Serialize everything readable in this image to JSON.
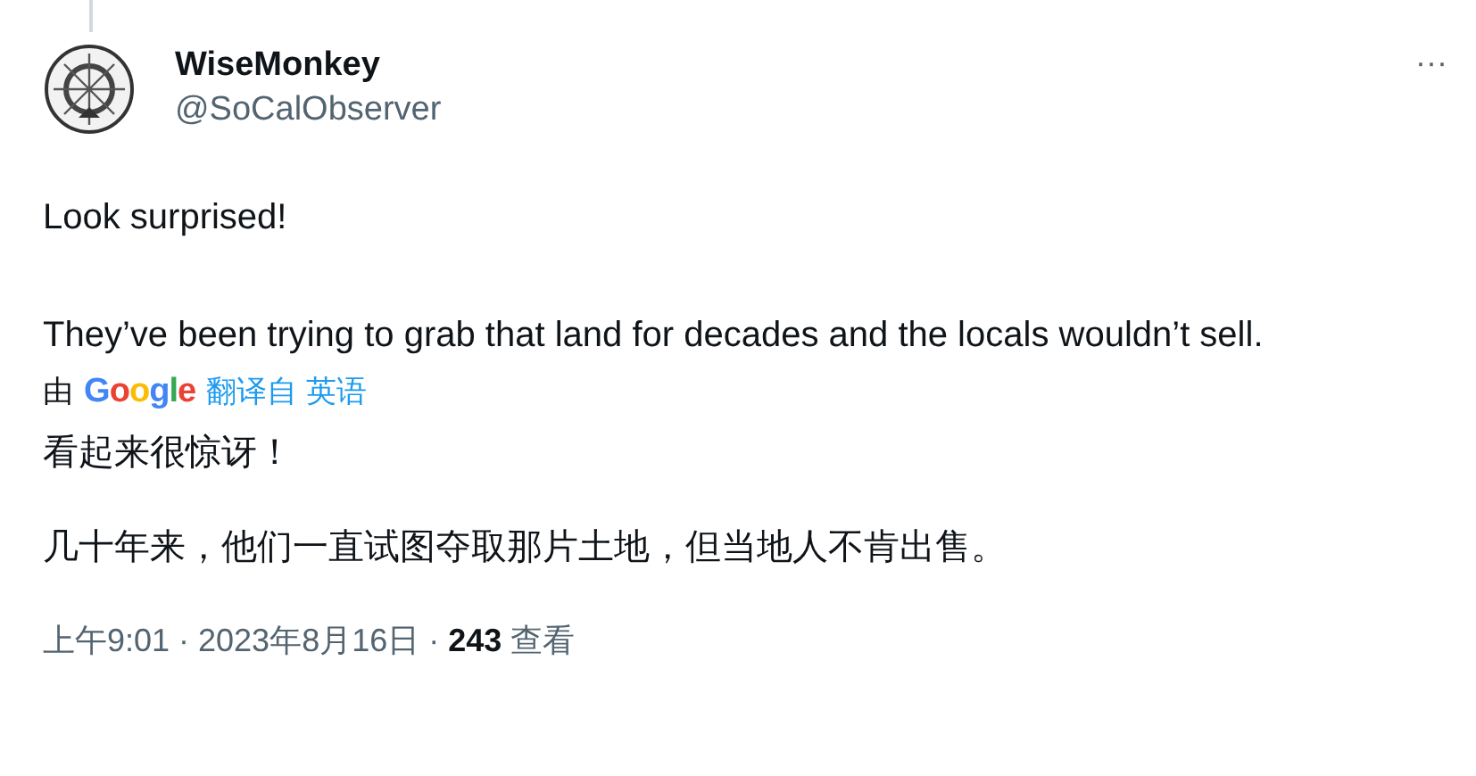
{
  "author": {
    "name": "WiseMonkey",
    "handle": "@SoCalObserver"
  },
  "more": "···",
  "paragraphs": [
    "Look surprised!",
    "They’ve been trying to grab that land for decades and the locals wouldn’t sell."
  ],
  "translation": {
    "by": "由",
    "brand": "Google",
    "link": "翻译自 英语",
    "paragraphs": [
      "看起来很惊讶！",
      "几十年来，他们一直试图夺取那片土地，但当地人不肯出售。"
    ]
  },
  "meta": {
    "time": "上午9:01 · 2023年8月16日 · ",
    "views": "243",
    "views_label": "查看"
  }
}
